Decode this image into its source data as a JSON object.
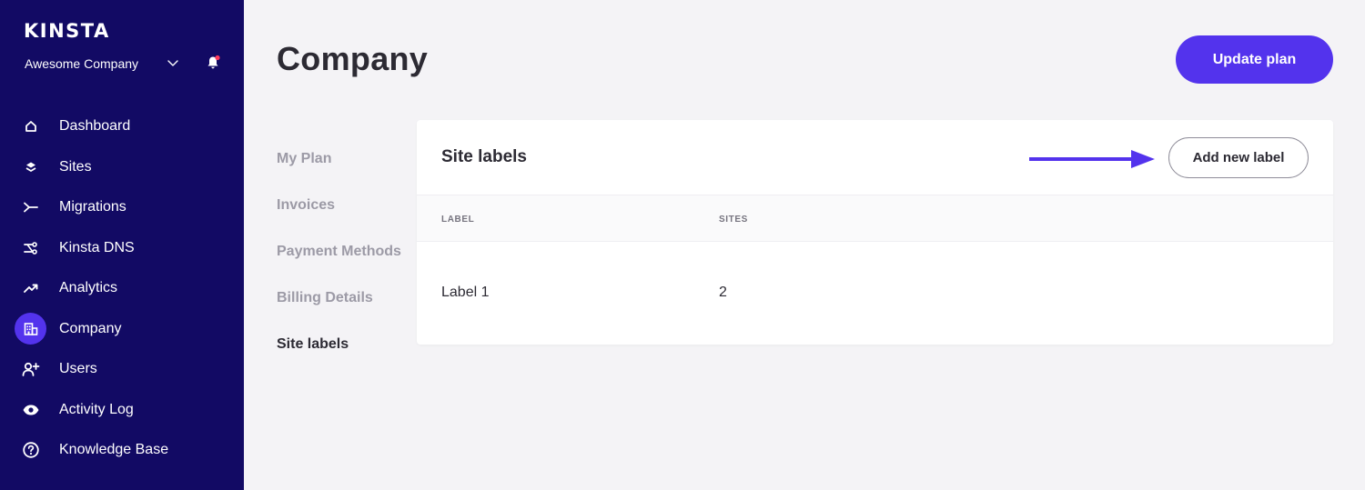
{
  "sidebar": {
    "logo": "KINSTA",
    "company": "Awesome Company",
    "items": [
      {
        "label": "Dashboard",
        "icon": "home-icon",
        "active": false
      },
      {
        "label": "Sites",
        "icon": "layers-icon",
        "active": false
      },
      {
        "label": "Migrations",
        "icon": "migrations-icon",
        "active": false
      },
      {
        "label": "Kinsta DNS",
        "icon": "dns-icon",
        "active": false
      },
      {
        "label": "Analytics",
        "icon": "analytics-icon",
        "active": false
      },
      {
        "label": "Company",
        "icon": "building-icon",
        "active": true
      },
      {
        "label": "Users",
        "icon": "user-plus-icon",
        "active": false
      },
      {
        "label": "Activity Log",
        "icon": "eye-icon",
        "active": false
      },
      {
        "label": "Knowledge Base",
        "icon": "help-icon",
        "active": false
      }
    ]
  },
  "header": {
    "title": "Company",
    "update_button": "Update plan"
  },
  "subnav": {
    "items": [
      "My Plan",
      "Invoices",
      "Payment Methods",
      "Billing Details",
      "Site labels"
    ],
    "active": "Site labels"
  },
  "card": {
    "title": "Site labels",
    "add_button": "Add new label",
    "columns": [
      "LABEL",
      "SITES"
    ],
    "rows": [
      {
        "label": "Label 1",
        "sites": "2"
      }
    ]
  },
  "colors": {
    "sidebar_bg": "#120a64",
    "accent": "#5333ed",
    "page_bg": "#f4f3f6",
    "notification_dot": "#ff3b5c"
  }
}
